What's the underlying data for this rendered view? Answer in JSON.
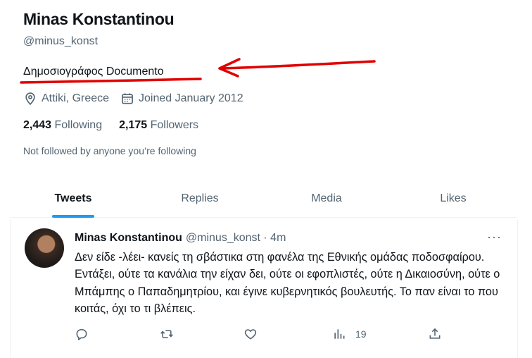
{
  "profile": {
    "name": "Minas Konstantinou",
    "handle": "@minus_konst",
    "bio": "Δημοσιογράφος Documento",
    "location": "Attiki, Greece",
    "joined": "Joined January 2012",
    "following_count": "2,443",
    "following_label": "Following",
    "followers_count": "2,175",
    "followers_label": "Followers",
    "not_followed": "Not followed by anyone you’re following"
  },
  "tabs": [
    {
      "label": "Tweets",
      "active": true
    },
    {
      "label": "Replies",
      "active": false
    },
    {
      "label": "Media",
      "active": false
    },
    {
      "label": "Likes",
      "active": false
    }
  ],
  "tweet": {
    "author": "Minas Konstantinou",
    "handle_time": "@minus_konst · 4m",
    "more": "···",
    "text": "Δεν είδε -λέει- κανείς τη σβάστικα στη φανέλα της Εθνικής ομάδας ποδοσφαίρου. Εντάξει, ούτε τα κανάλια την είχαν δει, ούτε οι εφοπλιστές, ούτε η Δικαιοσύνη, ούτε ο Μπάμπης ο Παπαδημητρίου, και έγινε κυβερνητικός βουλευτής. Το παν είναι το που κοιτάς, όχι το τι βλέπεις.",
    "views": "19"
  },
  "icons": {
    "location": "location-pin-icon",
    "calendar": "calendar-icon",
    "reply": "reply-icon",
    "retweet": "retweet-icon",
    "like": "heart-icon",
    "views": "views-icon",
    "share": "share-icon"
  },
  "colors": {
    "accent": "#1d9bf0",
    "annotation": "#e00000",
    "secondary_text": "#536471"
  }
}
